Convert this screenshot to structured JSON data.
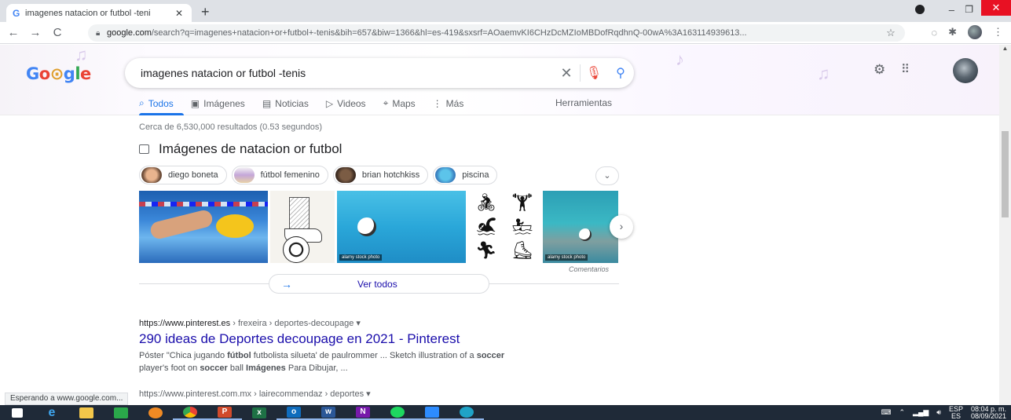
{
  "browser": {
    "tab_title": "imagenes natacion or futbol -teni",
    "tab_favicon": "G",
    "url_domain": "google.com",
    "url_rest": "/search?q=imagenes+natacion+or+futbol+-tenis&bih=657&biw=1366&hl=es-419&sxsrf=AOaemvKI6CHzDcMZIoMBDofRqdhnQ-00wA%3A163114939613...",
    "status_text": "Esperando a www.google.com..."
  },
  "google": {
    "logo_letters": [
      "G",
      "o",
      "⊙",
      "g",
      "l",
      "e"
    ],
    "query": "imagenes natacion or futbol -tenis",
    "tabs": [
      {
        "label": "Todos",
        "icon": "⌕"
      },
      {
        "label": "Imágenes",
        "icon": "▣"
      },
      {
        "label": "Noticias",
        "icon": "▤"
      },
      {
        "label": "Videos",
        "icon": "▷"
      },
      {
        "label": "Maps",
        "icon": "⌖"
      },
      {
        "label": "Más",
        "icon": "⋮"
      }
    ],
    "tools_label": "Herramientas",
    "stats": "Cerca de 6,530,000 resultados (0.53 segundos)"
  },
  "images": {
    "heading": "Imágenes de natacion or futbol",
    "chips": [
      "diego boneta",
      "fútbol femenino",
      "brian hotchkiss",
      "piscina"
    ],
    "badge_text": "alamy stock photo",
    "feedback": "Comentarios",
    "see_all": "Ver todos"
  },
  "result1": {
    "domain": "https://www.pinterest.es",
    "path": " › frexeira › deportes-decoupage  ▾",
    "title": "290 ideas de Deportes decoupage en 2021 - Pinterest",
    "snippet_1": "Póster \"Chica jugando ",
    "snippet_b1": "fútbol",
    "snippet_2": " futbolista silueta' de paulrommer ... Sketch illustration of a ",
    "snippet_b2": "soccer",
    "snippet_3": " player's foot on ",
    "snippet_b3": "soccer",
    "snippet_4": " ball ",
    "snippet_b4": "Imágenes",
    "snippet_5": " Para Dibujar, ..."
  },
  "result2": {
    "cite": "https://www.pinterest.com.mx › lairecommendaz › deportes  ▾"
  },
  "taskbar": {
    "lang": "ESP",
    "lang_sub": "ES",
    "time": "08:04 p. m.",
    "date": "08/09/2021"
  },
  "colors": {
    "link_blue": "#1a0dab",
    "accent_blue": "#1a73e8",
    "close_red": "#e81123"
  }
}
